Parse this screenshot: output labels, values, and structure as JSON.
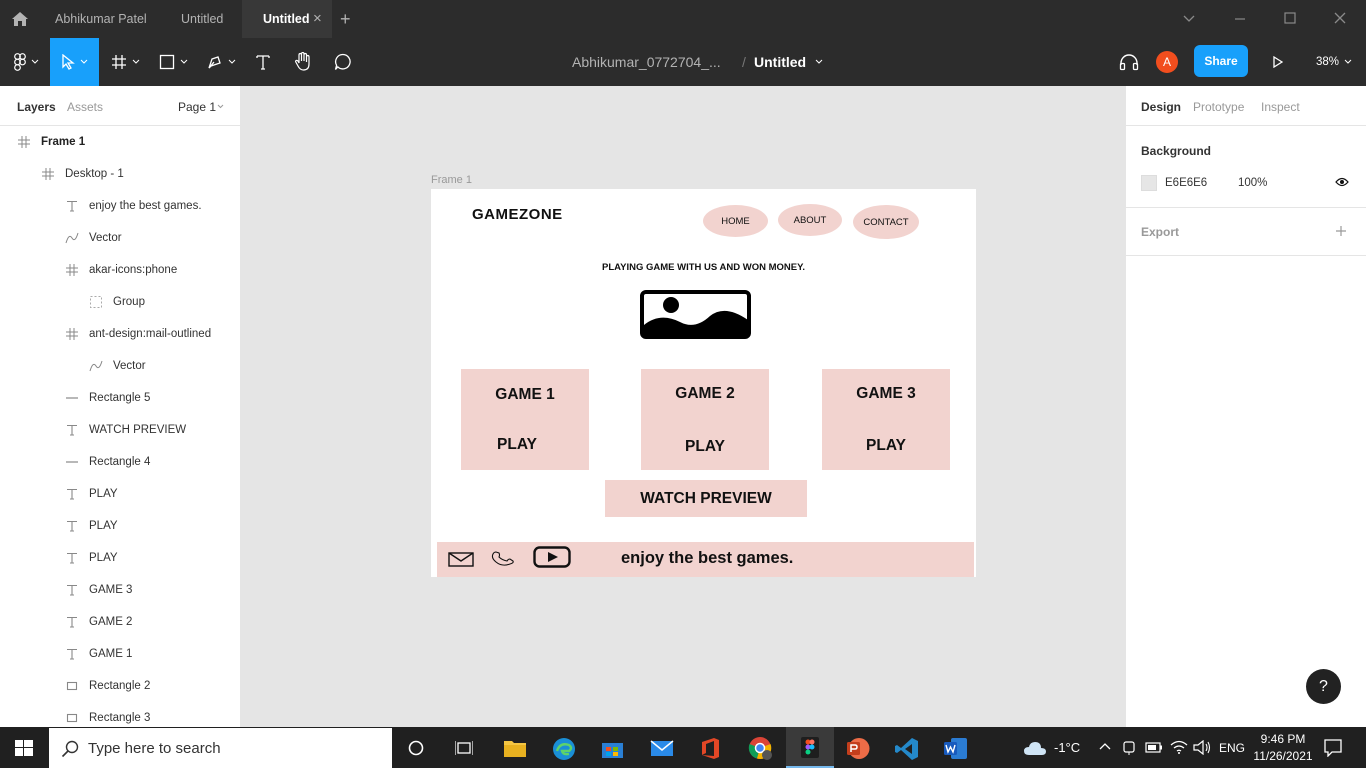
{
  "tabbar": {
    "tabs": [
      {
        "label": "Abhikumar Patel"
      },
      {
        "label": "Untitled"
      },
      {
        "label": "Untitled",
        "active": true
      }
    ],
    "new_tab": "+",
    "close": "×"
  },
  "toolbar": {
    "project": "Abhikumar_0772704_...",
    "separator": "/",
    "file_name": "Untitled",
    "avatar_initial": "A",
    "share_label": "Share",
    "zoom": "38%"
  },
  "left_panel": {
    "tabs": [
      "Layers",
      "Assets"
    ],
    "page": "Page 1",
    "layers": [
      {
        "label": "Frame 1",
        "icon": "frame-icon",
        "indent": 0
      },
      {
        "label": "Desktop - 1",
        "icon": "frame-icon",
        "indent": 1
      },
      {
        "label": "enjoy the best games.",
        "icon": "text-icon",
        "indent": 2
      },
      {
        "label": "Vector",
        "icon": "vector-icon",
        "indent": 2
      },
      {
        "label": "akar-icons:phone",
        "icon": "frame-icon",
        "indent": 2
      },
      {
        "label": "Group",
        "icon": "group-icon",
        "indent": 3
      },
      {
        "label": "ant-design:mail-outlined",
        "icon": "frame-icon",
        "indent": 2
      },
      {
        "label": "Vector",
        "icon": "vector-icon",
        "indent": 3
      },
      {
        "label": "Rectangle 5",
        "icon": "line-icon",
        "indent": 2
      },
      {
        "label": "WATCH PREVIEW",
        "icon": "text-icon",
        "indent": 2
      },
      {
        "label": "Rectangle 4",
        "icon": "line-icon",
        "indent": 2
      },
      {
        "label": "PLAY",
        "icon": "text-icon",
        "indent": 2
      },
      {
        "label": "PLAY",
        "icon": "text-icon",
        "indent": 2
      },
      {
        "label": "PLAY",
        "icon": "text-icon",
        "indent": 2
      },
      {
        "label": "GAME 3",
        "icon": "text-icon",
        "indent": 2
      },
      {
        "label": "GAME 2",
        "icon": "text-icon",
        "indent": 2
      },
      {
        "label": "GAME 1",
        "icon": "text-icon",
        "indent": 2
      },
      {
        "label": "Rectangle 2",
        "icon": "rectangle-icon",
        "indent": 2
      },
      {
        "label": "Rectangle 3",
        "icon": "rectangle-icon",
        "indent": 2
      }
    ]
  },
  "canvas": {
    "frame_label": "Frame 1",
    "site": {
      "title": "GAMEZONE",
      "nav": [
        "HOME",
        "ABOUT",
        "CONTACT"
      ],
      "tagline": "PLAYING  GAME WITH US AND WON MONEY.",
      "cards": [
        {
          "game": "GAME 1",
          "play": "PLAY"
        },
        {
          "game": "GAME 2",
          "play": "PLAY"
        },
        {
          "game": "GAME 3",
          "play": "PLAY"
        }
      ],
      "watch": "WATCH PREVIEW",
      "footer_text": "enjoy the best games."
    }
  },
  "right_panel": {
    "tabs": [
      "Design",
      "Prototype",
      "Inspect"
    ],
    "background_label": "Background",
    "bg_hex": "E6E6E6",
    "bg_opacity": "100%",
    "export_label": "Export"
  },
  "taskbar": {
    "search_placeholder": "Type here to search",
    "weather": "-1°C",
    "lang": "ENG",
    "time": "9:46 PM",
    "date": "11/26/2021"
  },
  "help_label": "?",
  "colors": {
    "accent": "#18a0fb",
    "card": "#f2d3cf",
    "avatar": "#f24e1e"
  }
}
